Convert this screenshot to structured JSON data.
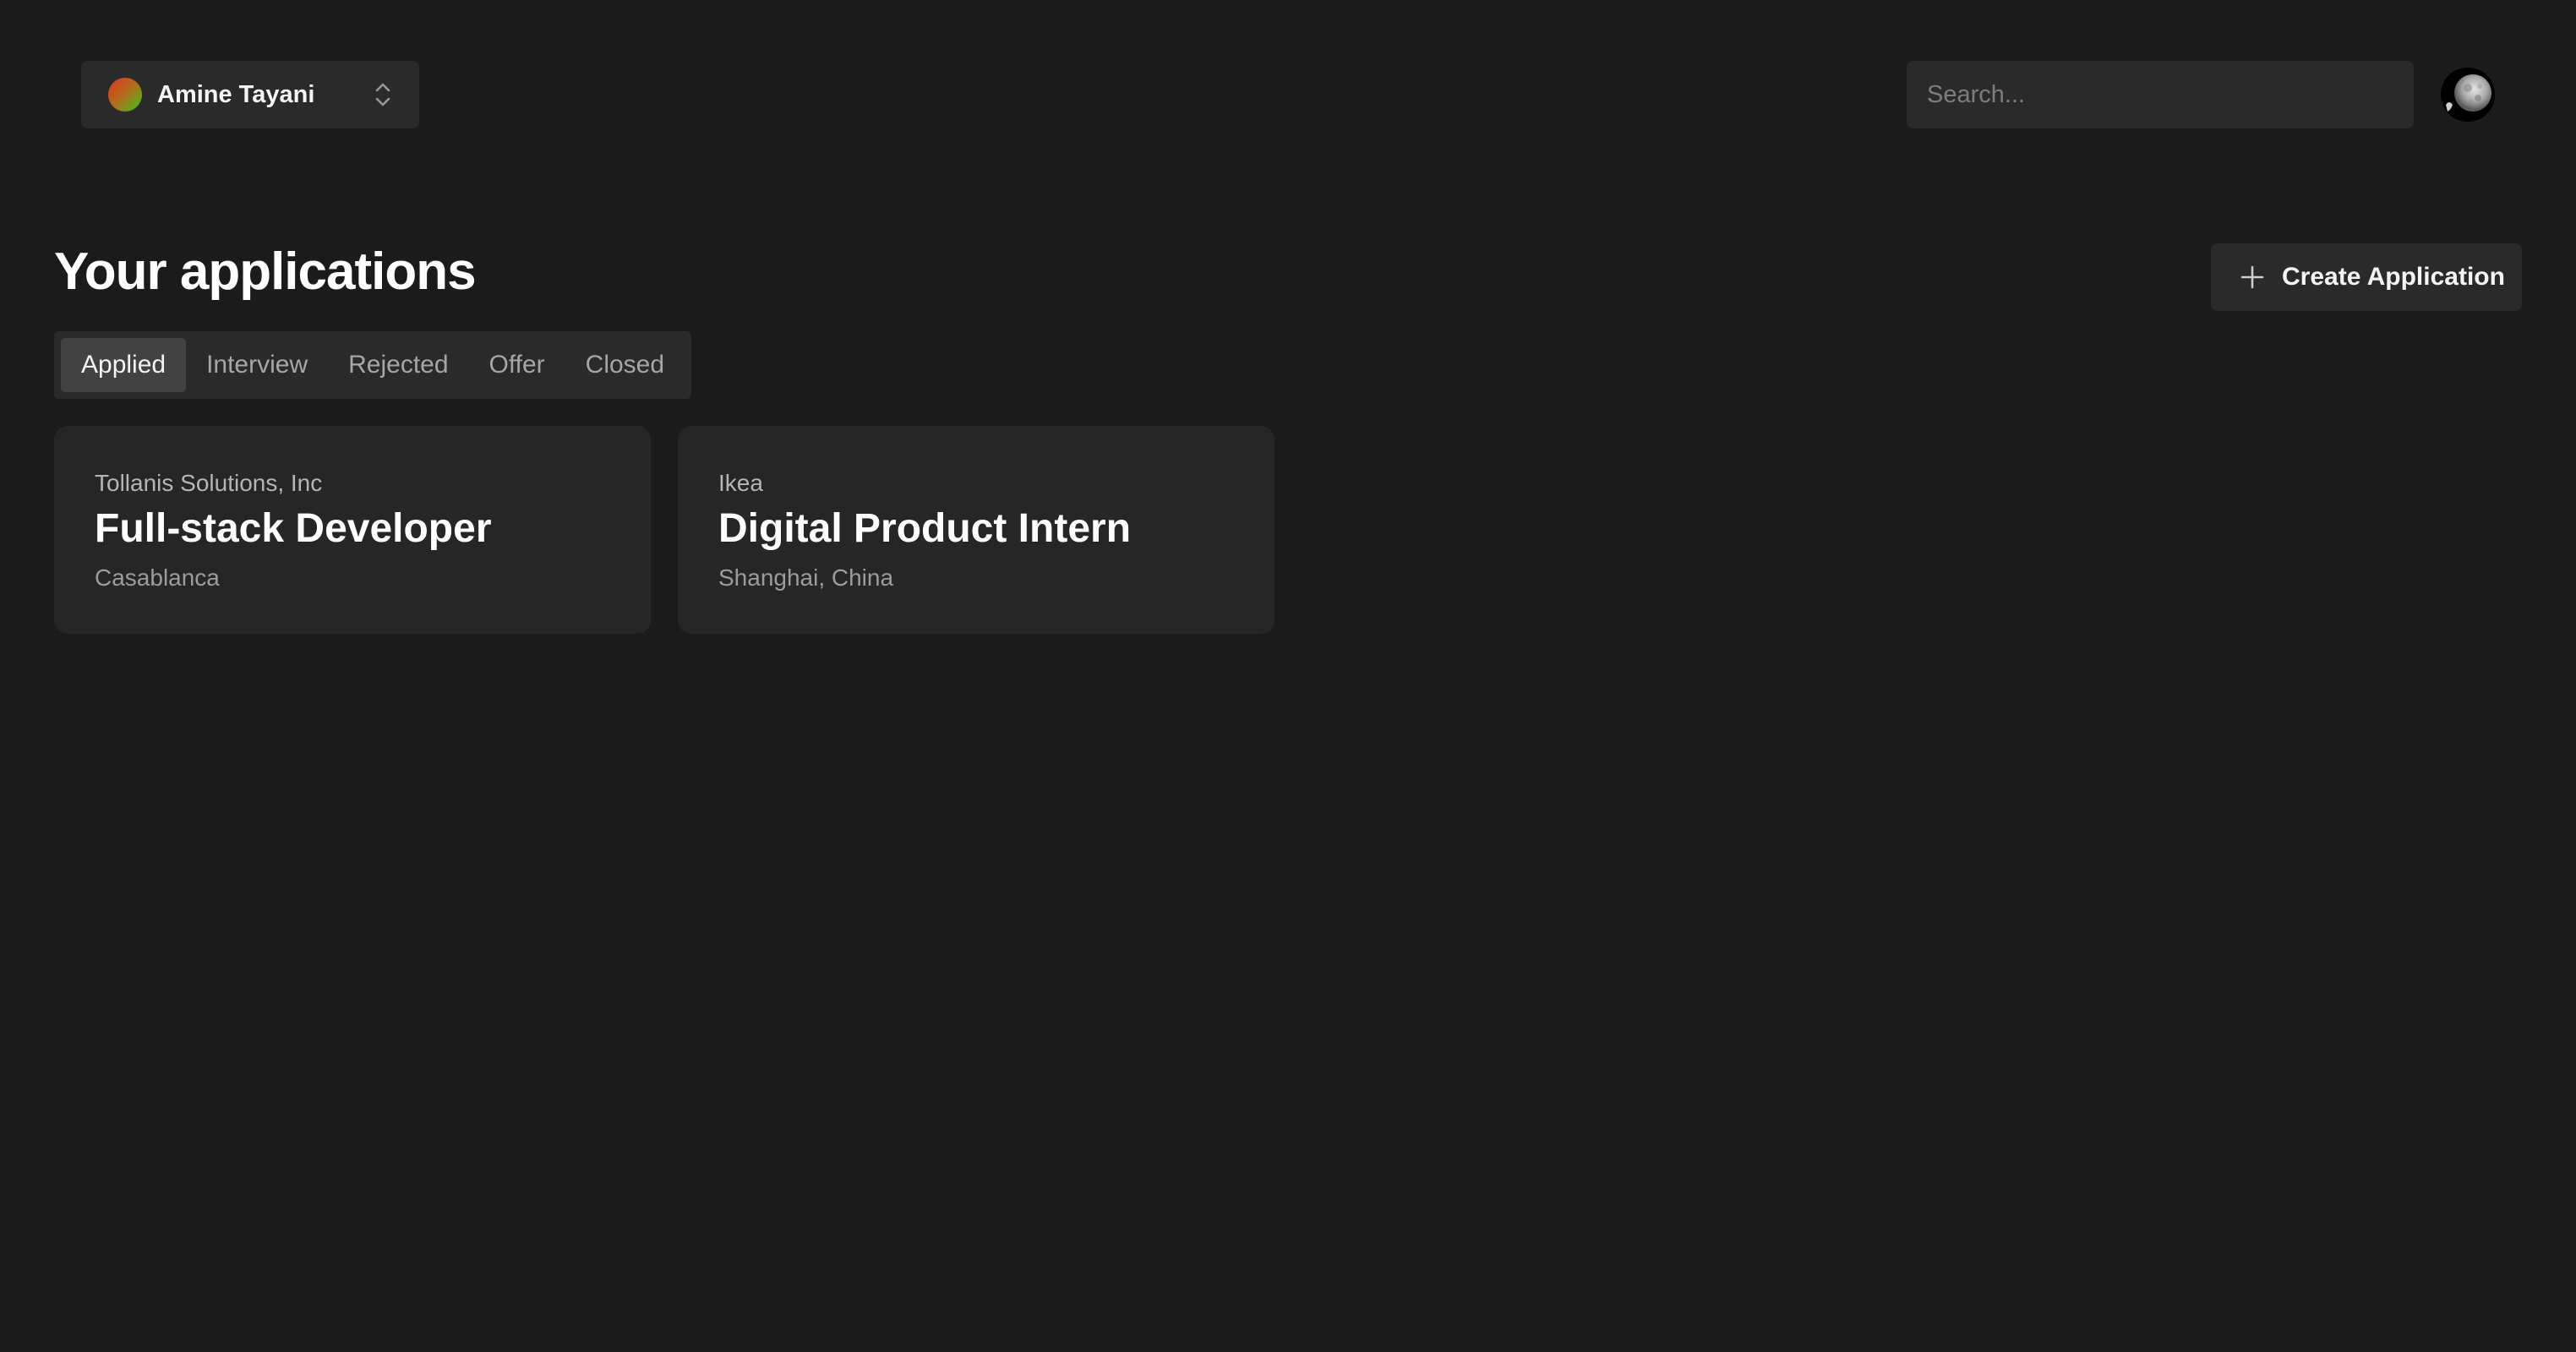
{
  "header": {
    "account": {
      "name": "Amine Tayani",
      "icon": "gradient-dot-icon",
      "switcher_icon": "chevron-up-down-icon"
    },
    "search": {
      "placeholder": "Search...",
      "value": ""
    },
    "avatar": {
      "icon": "user-avatar-moon"
    }
  },
  "main": {
    "title": "Your applications",
    "create_button": {
      "label": "Create Application",
      "icon": "plus-icon"
    },
    "tabs": [
      {
        "label": "Applied",
        "active": true
      },
      {
        "label": "Interview",
        "active": false
      },
      {
        "label": "Rejected",
        "active": false
      },
      {
        "label": "Offer",
        "active": false
      },
      {
        "label": "Closed",
        "active": false
      }
    ],
    "applications": [
      {
        "company": "Tollanis Solutions, Inc",
        "position": "Full-stack Developer",
        "location": "Casablanca"
      },
      {
        "company": "Ikea",
        "position": "Digital Product Intern",
        "location": "Shanghai, China"
      }
    ]
  },
  "colors": {
    "background": "#1b1b1b",
    "surface": "#2a2a2a",
    "card": "#262626",
    "active_tab": "#424242",
    "text_primary": "#ffffff",
    "text_muted": "#a6a6a6"
  }
}
